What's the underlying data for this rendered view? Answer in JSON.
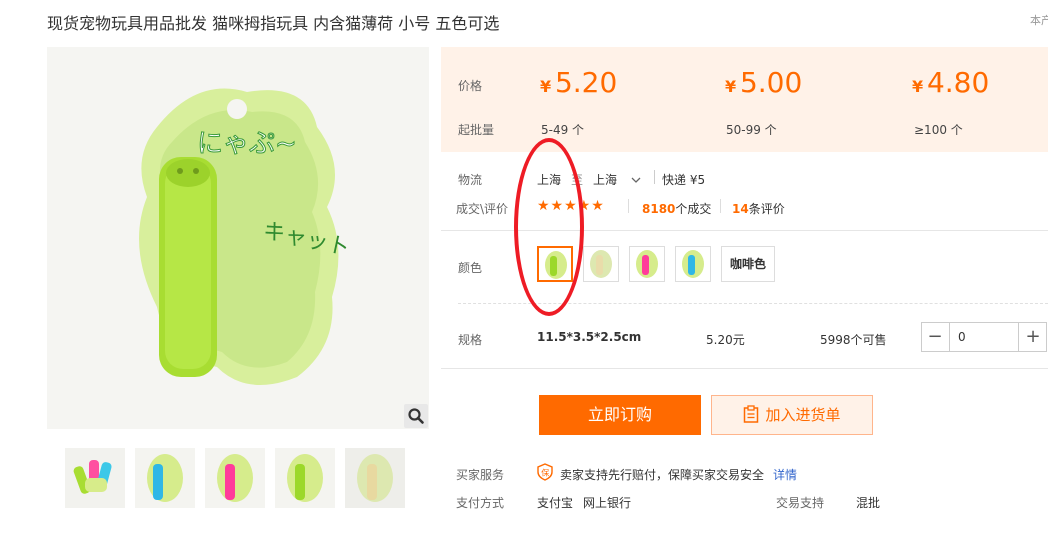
{
  "product": {
    "title": "现货宠物玩具用品批发 猫咪拇指玩具 内含猫薄荷 小号 五色可选",
    "corner_text": "本产"
  },
  "pricing": {
    "price_label": "价格",
    "moq_label": "起批量",
    "currency_symbol": "¥",
    "tiers": [
      {
        "price": "5.20",
        "qty": "5-49 个"
      },
      {
        "price": "5.00",
        "qty": "50-99 个"
      },
      {
        "price": "4.80",
        "qty": "≥100 个"
      }
    ]
  },
  "logistics": {
    "label": "物流",
    "from": "上海",
    "to_connector": "至",
    "to": "上海",
    "shipping": "快递 ¥5"
  },
  "trade": {
    "label": "成交\\评价",
    "stars": "★★★★★",
    "deals_count": "8180",
    "deals_suffix": "个成交",
    "reviews_count": "14",
    "reviews_suffix": "条评价"
  },
  "color": {
    "label": "颜色",
    "text_option": "咖啡色"
  },
  "spec": {
    "label": "规格",
    "size": "11.5*3.5*2.5cm",
    "price": "5.20元",
    "stock": "5998个可售",
    "minus": "−",
    "plus": "+",
    "quantity": "0"
  },
  "actions": {
    "buy_now": "立即订购",
    "add_cart": "加入进货单"
  },
  "services": {
    "buyer_label": "买家服务",
    "buyer_text": "卖家支持先行赔付，保障买家交易安全",
    "details_link": "详情",
    "payment_label": "支付方式",
    "alipay": "支付宝",
    "bank": "网上银行",
    "trade_support_label": "交易支持",
    "trade_support_value": "混批"
  },
  "colors": {
    "accent": "#ff6a00",
    "price_bg": "#fff2e8",
    "annotation": "#ee1c25",
    "link": "#3366cc"
  },
  "icons": [
    "search-icon",
    "chevron-down-icon",
    "guarantee-icon",
    "clipboard-icon"
  ]
}
